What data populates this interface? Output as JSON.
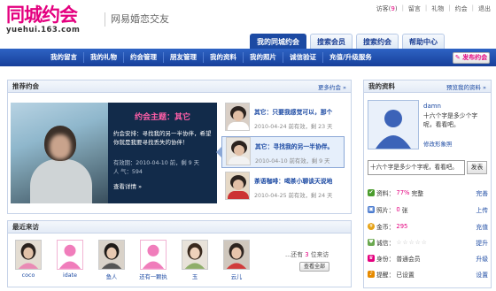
{
  "brand": {
    "name_cn": "同城约会",
    "domain": "yuehui.163.com",
    "slogan": "网易婚恋交友"
  },
  "toplinks": [
    {
      "label": "访客",
      "count": "9"
    },
    {
      "label": "留言"
    },
    {
      "label": "礼物"
    },
    {
      "label": "约会"
    },
    {
      "label": "退出"
    }
  ],
  "tabs": [
    "我的同城约会",
    "搜索会员",
    "搜索约会",
    "帮助中心"
  ],
  "subnav": [
    "我的留言",
    "我的礼物",
    "约会管理",
    "朋友管理",
    "我的资料",
    "我的照片",
    "诚信验证",
    "充值/升级服务"
  ],
  "publish_label": "发布约会",
  "recommend": {
    "title": "推荐约会",
    "more": "更多约会 »",
    "feature": {
      "title": "约会主题：其它",
      "desc": "约会安排：寻找我的另一半协伴，希望你就是我要寻找丢失的协伴！",
      "meta1": "有效期：2010-04-10 前，剩 9 天",
      "meta2": "人 气：594",
      "more": "查看详情 »"
    },
    "items": [
      {
        "title": "其它：只要我感觉可以，那个",
        "date": "2010-04-24 前有效，剩 23 天"
      },
      {
        "title": "其它：寻找我的另一半协伴。",
        "date": "2010-04-10 前有效，剩 9 天"
      },
      {
        "title": "茶语咖啡：喝茶小聊谈天说地",
        "date": "2010-04-25 前有效，剩 24 天"
      }
    ]
  },
  "visitors": {
    "title": "最近来访",
    "list": [
      {
        "name": "coco",
        "type": "photo"
      },
      {
        "name": "idate",
        "type": "pink"
      },
      {
        "name": "鱼人",
        "type": "photo"
      },
      {
        "name": "还有一颗执",
        "type": "pink"
      },
      {
        "name": "玉",
        "type": "photo"
      },
      {
        "name": "云儿",
        "type": "photo"
      }
    ],
    "more_text_pre": "...还有 ",
    "more_count": "3",
    "more_text_post": " 位来访",
    "see_all": "查看全部"
  },
  "profile": {
    "title": "我的资料",
    "more": "预览我的资料 »",
    "username": "damn",
    "bio": "十六个字是多少个字呢，看看吧。",
    "edit": "修改形象照",
    "status_input": "十六个字是多少个字呢，看看吧。",
    "status_btn": "发表",
    "rows": [
      {
        "label": "资料：",
        "value": "77%",
        "extra": "完整",
        "action": "完善",
        "color": "#4a9c2d",
        "icon": "profile-icon"
      },
      {
        "label": "照片：",
        "value": "0",
        "extra": "张",
        "action": "上传",
        "color": "#4b7bcf",
        "icon": "photo-icon"
      },
      {
        "label": "金币：",
        "value": "295",
        "extra": "",
        "action": "充值",
        "color": "#e6a317",
        "icon": "coin-icon"
      },
      {
        "label": "诚信：",
        "value": "",
        "extra": "",
        "action": "提升",
        "color": "#6aa84f",
        "icon": "credit-icon"
      },
      {
        "label": "身份：",
        "value": "普通会员",
        "extra": "",
        "action": "升级",
        "color": "#e4007f",
        "icon": "member-icon"
      },
      {
        "label": "提醒：",
        "value": "已设置",
        "extra": "",
        "action": "设置",
        "color": "#e68a00",
        "icon": "bell-icon"
      }
    ]
  }
}
